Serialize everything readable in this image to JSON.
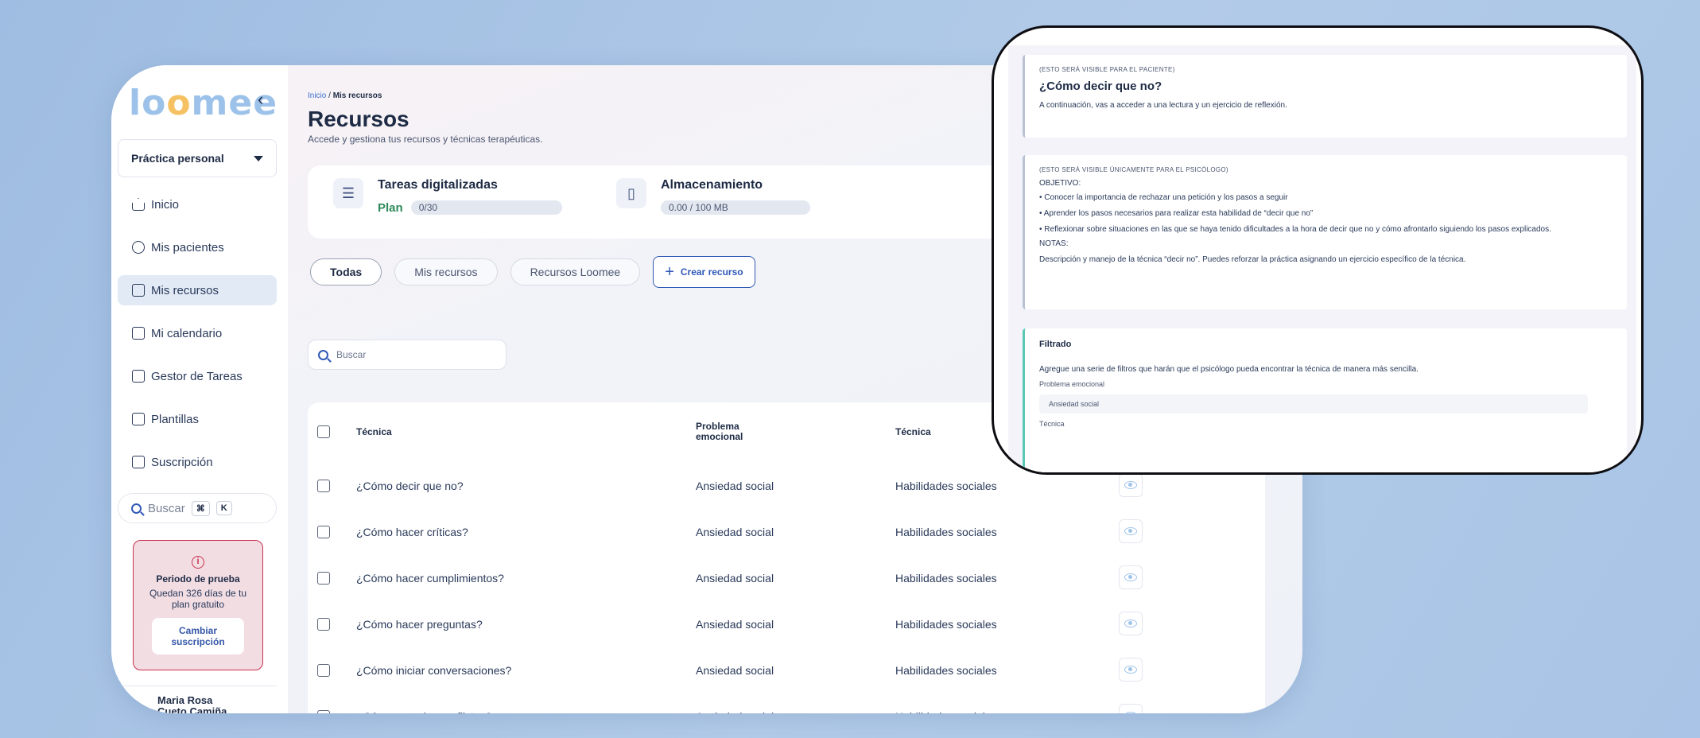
{
  "sidebar": {
    "logo": {
      "part1": "lo",
      "part2": "o",
      "part3": "mee"
    },
    "collapse_icon": "chevron-left-icon",
    "workspace": "Práctica personal",
    "nav": [
      {
        "label": "Inicio",
        "icon": "home-icon"
      },
      {
        "label": "Mis pacientes",
        "icon": "patients-icon"
      },
      {
        "label": "Mis recursos",
        "icon": "resources-icon",
        "active": true
      },
      {
        "label": "Mi calendario",
        "icon": "calendar-icon"
      },
      {
        "label": "Gestor de Tareas",
        "icon": "tasks-icon"
      },
      {
        "label": "Plantillas",
        "icon": "templates-icon"
      },
      {
        "label": "Suscripción",
        "icon": "subscription-icon"
      }
    ],
    "search": {
      "placeholder": "Buscar",
      "key1": "⌘",
      "key2": "K"
    },
    "trial": {
      "icon": "i",
      "title": "Periodo de prueba",
      "text": "Quedan 326 días de tu plan gratuito",
      "button": "Cambiar suscripción"
    },
    "user": {
      "line1": "Maria Rosa",
      "line2": "Cueto Camiña"
    }
  },
  "header": {
    "breadcrumb": {
      "home": "Inicio",
      "sep": "/",
      "current": "Mis recursos"
    },
    "title": "Recursos",
    "subtitle": "Accede y gestiona tus recursos y técnicas terapéuticas."
  },
  "stats": {
    "tasks": {
      "title": "Tareas digitalizadas",
      "plan_label": "Plan",
      "usage": "0/30",
      "icon": "checklist-icon"
    },
    "storage": {
      "title": "Almacenamiento",
      "usage": "0.00 / 100 MB",
      "icon": "sd-card-icon"
    }
  },
  "filters": {
    "all": "Todas",
    "mine": "Mis recursos",
    "loomee": "Recursos Loomee",
    "create": "Crear recurso"
  },
  "search": {
    "placeholder": "Buscar"
  },
  "table": {
    "headers": {
      "tecnica": "Técnica",
      "problema": "Problema emocional",
      "tipo": "Técnica"
    },
    "rows": [
      {
        "name": "¿Cómo decir que no?",
        "problem": "Ansiedad social",
        "technique": "Habilidades sociales"
      },
      {
        "name": "¿Cómo hacer críticas?",
        "problem": "Ansiedad social",
        "technique": "Habilidades sociales"
      },
      {
        "name": "¿Cómo hacer cumplimientos?",
        "problem": "Ansiedad social",
        "technique": "Habilidades sociales"
      },
      {
        "name": "¿Cómo hacer preguntas?",
        "problem": "Ansiedad social",
        "technique": "Habilidades sociales"
      },
      {
        "name": "¿Cómo iniciar conversaciones?",
        "problem": "Ansiedad social",
        "technique": "Habilidades sociales"
      },
      {
        "name": "¿Cómo manejar conflictos?",
        "problem": "Ansiedad social",
        "technique": "Habilidades sociales"
      }
    ]
  },
  "detail": {
    "card1": {
      "tag": "(ESTO SERÁ VISIBLE PARA EL PACIENTE)",
      "title": "¿Cómo decir que no?",
      "text": "A continuación, vas a acceder a una lectura y un ejercicio de reflexión."
    },
    "card2": {
      "tag": "(ESTO SERÁ VISIBLE ÚNICAMENTE PARA EL PSICÓLOGO)",
      "objective_label": "OBJETIVO:",
      "bullets": [
        "• Conocer la importancia de rechazar una petición y los pasos a seguir",
        "• Aprender los pasos necesarios para realizar esta habilidad de “decir que no”",
        "• Reflexionar sobre situaciones en las que se haya tenido dificultades a la hora de decir que no y cómo afrontarlo siguiendo los pasos explicados."
      ],
      "notes_label": "NOTAS:",
      "notes": "Descripción y manejo de la técnica “decir no”. Puedes reforzar la práctica asignando un ejercicio específico de la técnica."
    },
    "card3": {
      "title": "Filtrado",
      "text": "Agregue una serie de filtros que harán que el psicólogo pueda encontrar la técnica de manera más sencilla.",
      "field1_label": "Problema emocional",
      "field1_value": "Ansiedad social",
      "field2_label": "Técnica"
    }
  }
}
